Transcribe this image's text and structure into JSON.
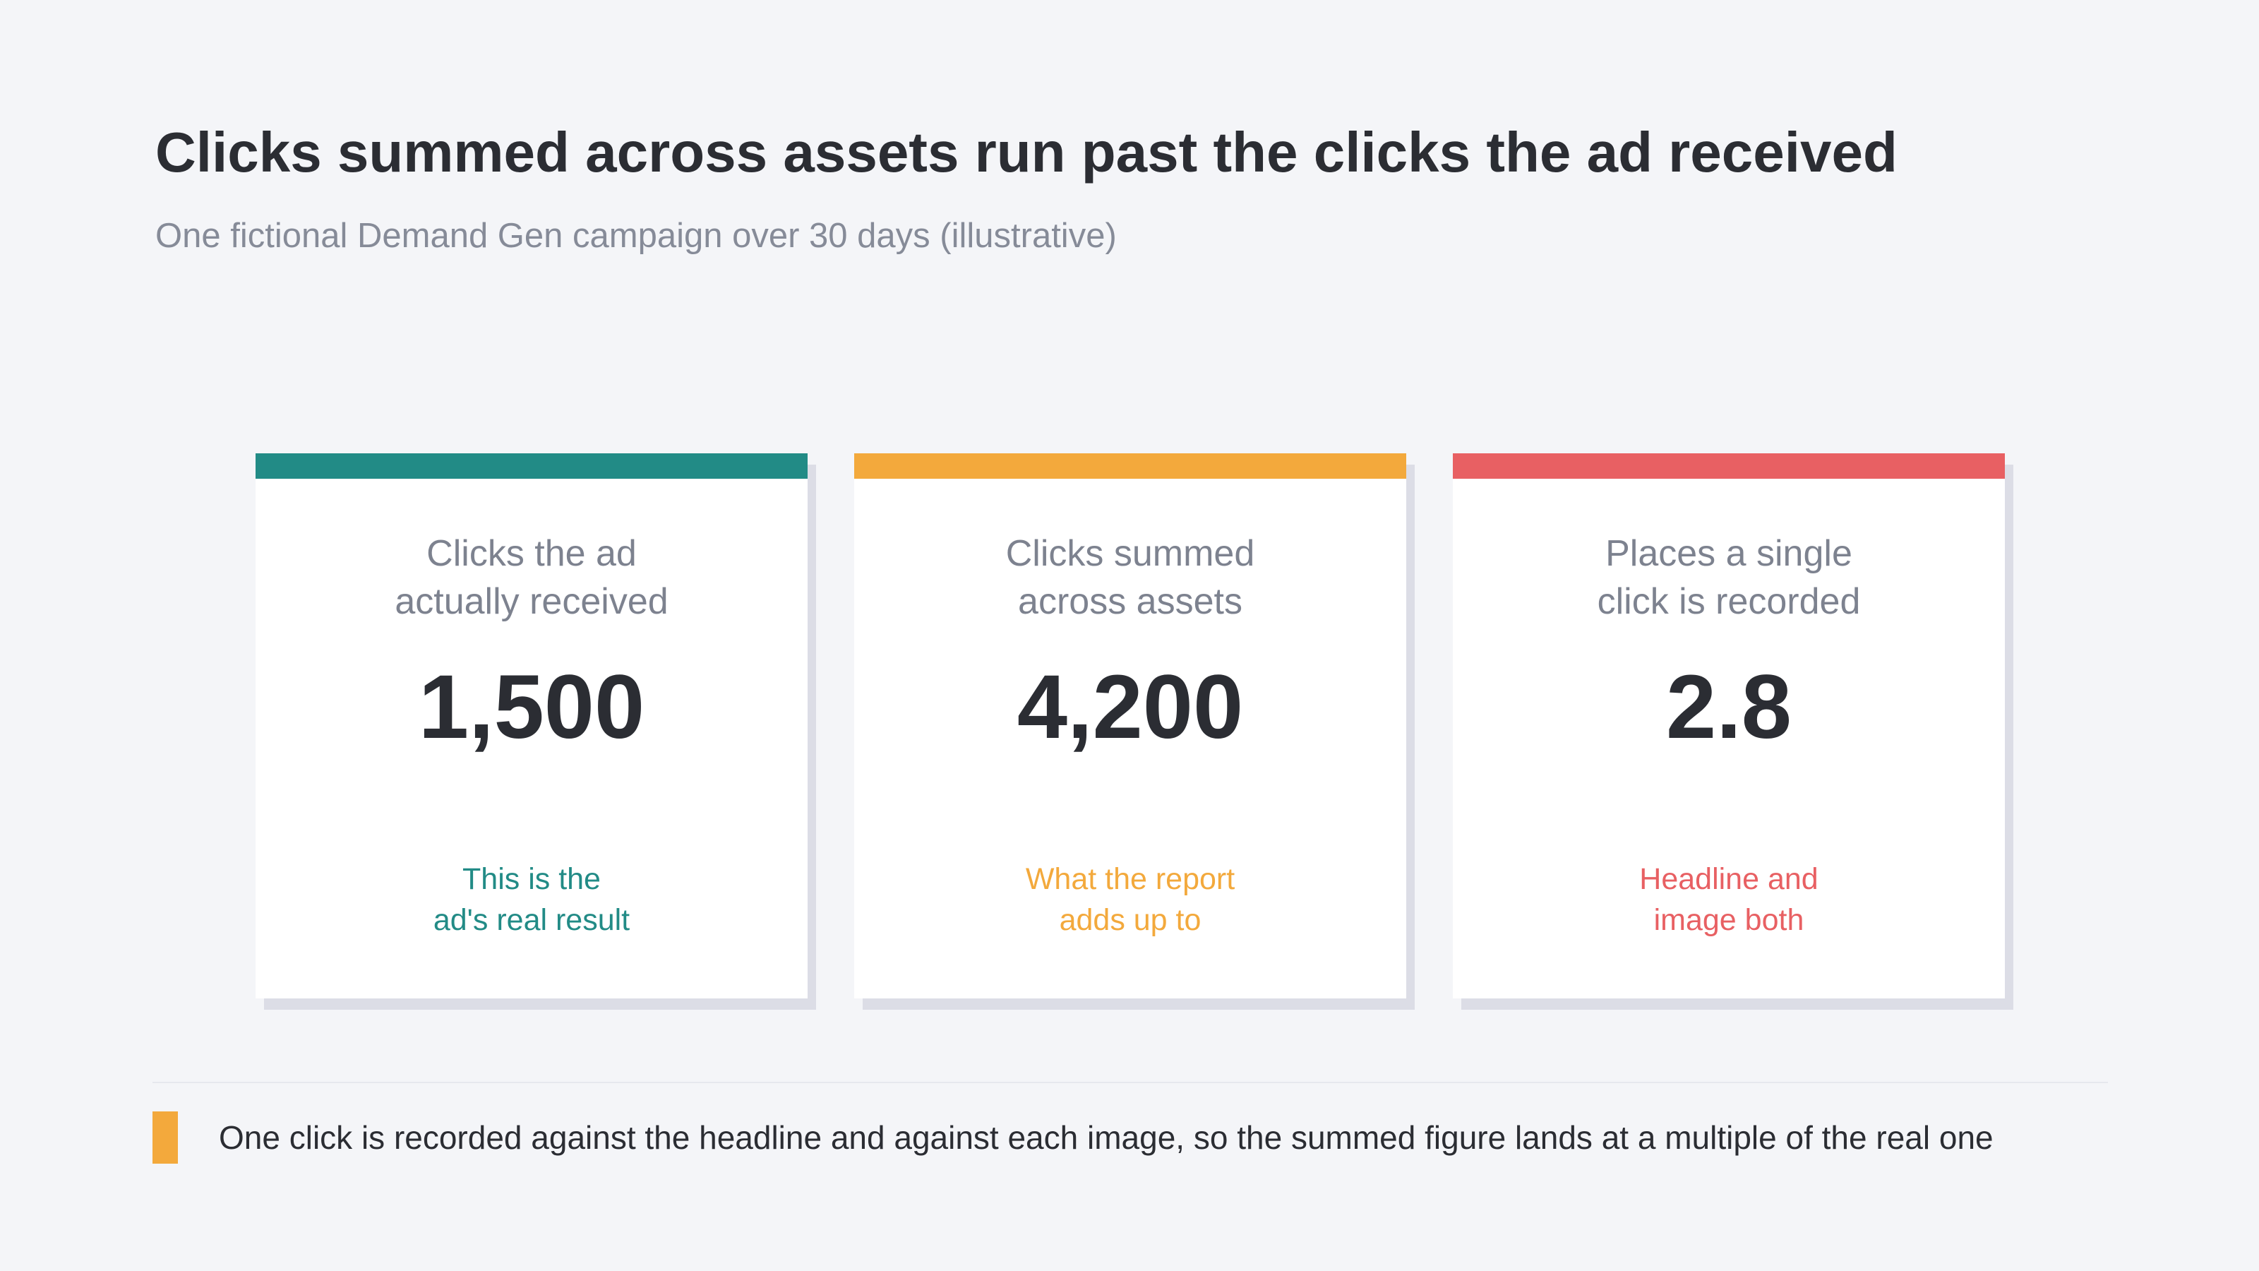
{
  "header": {
    "title": "Clicks summed across assets run past the clicks the ad received",
    "subtitle": "One fictional Demand Gen campaign over 30 days (illustrative)"
  },
  "cards": [
    {
      "label": "Clicks the ad\nactually received",
      "value": "1,500",
      "note": "This is the\nad's real result",
      "accent": "#228b86"
    },
    {
      "label": "Clicks summed\nacross assets",
      "value": "4,200",
      "note": "What the report\nadds up to",
      "accent": "#f3a93c"
    },
    {
      "label": "Places a single\nclick is recorded",
      "value": "2.8",
      "note": "Headline and\nimage both",
      "accent": "#e86063"
    }
  ],
  "footer": {
    "text": "One click is recorded against the headline and against each image, so the summed figure lands at a multiple of the real one",
    "marker_color": "#f3a93c"
  }
}
